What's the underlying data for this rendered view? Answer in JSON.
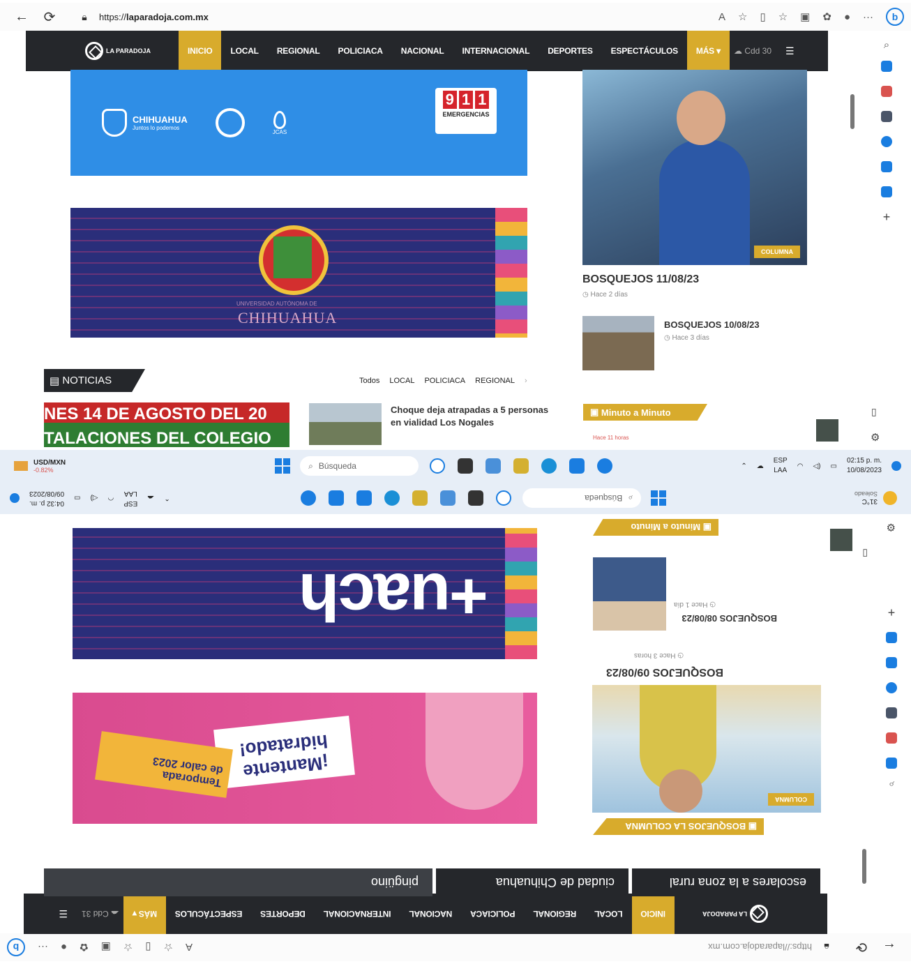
{
  "browser": {
    "url_prefix": "https://",
    "url_domain": "laparadoja.com.mx",
    "url_bottom": "https://laparadoja.com.mx"
  },
  "site": {
    "logo_text": "LA PARADOJA",
    "nav": [
      "INICIO",
      "LOCAL",
      "REGIONAL",
      "POLICIACA",
      "NACIONAL",
      "INTERNACIONAL",
      "DEPORTES",
      "ESPECTÁCULOS"
    ],
    "more_label": "MÁS",
    "weather_top": "Cdd 30",
    "weather_bottom": "Cdd 31"
  },
  "banners": {
    "gov_brand": "CHIHUAHUA",
    "gov_slogan": "Juntos lo podemos",
    "jcas": "JCAS",
    "digits_911": [
      "9",
      "1",
      "1"
    ],
    "emergencias": "EMERGENCIAS",
    "uach_sub": "UNIVERSIDAD AUTÓNOMA DE",
    "uach_name": "CHIHUAHUA",
    "mas_uach": "+uach",
    "hidratado_l1": "¡Mantente",
    "hidratado_l2": "hidratado!",
    "temporada_l1": "Temporada",
    "temporada_l2": "de calor 2023"
  },
  "sidebar_posts": {
    "top_title": "BOSQUEJOS 11/08/23",
    "top_time": "Hace 2 días",
    "second_title": "BOSQUEJOS 10/08/23",
    "second_time": "Hace 3 días",
    "columna_tag": "COLUMNA",
    "mam_label": "Minuto a Minuto",
    "mam_time": "Hace 11 horas",
    "bottom_second_title": "BOSQUEJOS 08/08/23",
    "bottom_second_time": "Hace 1 día",
    "bottom_top_title": "BOSQUEJOS 09/08/23",
    "bottom_top_time": "Hace 3 horas",
    "bosquejos_columna": "BOSQUEJOS LA COLUMNA"
  },
  "noticias": {
    "label": "NOTICIAS",
    "filters": [
      "Todos",
      "LOCAL",
      "POLICIACA",
      "REGIONAL"
    ],
    "date_line1": "NES 14 DE AGOSTO DEL 20",
    "date_line2": "TALACIONES DEL COLEGIO",
    "story_title": "Choque deja atrapadas a 5 personas en vialidad Los Nogales"
  },
  "taskbar": {
    "ticker_label": "USD/MXN",
    "ticker_value": "-0.82%",
    "search_placeholder": "Búsqueda",
    "lang": "ESP",
    "region": "LAA",
    "time": "02:15 p. m.",
    "date": "10/08/2023",
    "weather_label": "Soleado",
    "weather_temp": "31°C",
    "time2": "04:32 p. m.",
    "date2": "09/08/2023"
  },
  "bottom_cards": [
    "ciudad de Chihuahua",
    "escolares a la zona rural",
    "pingüino"
  ]
}
